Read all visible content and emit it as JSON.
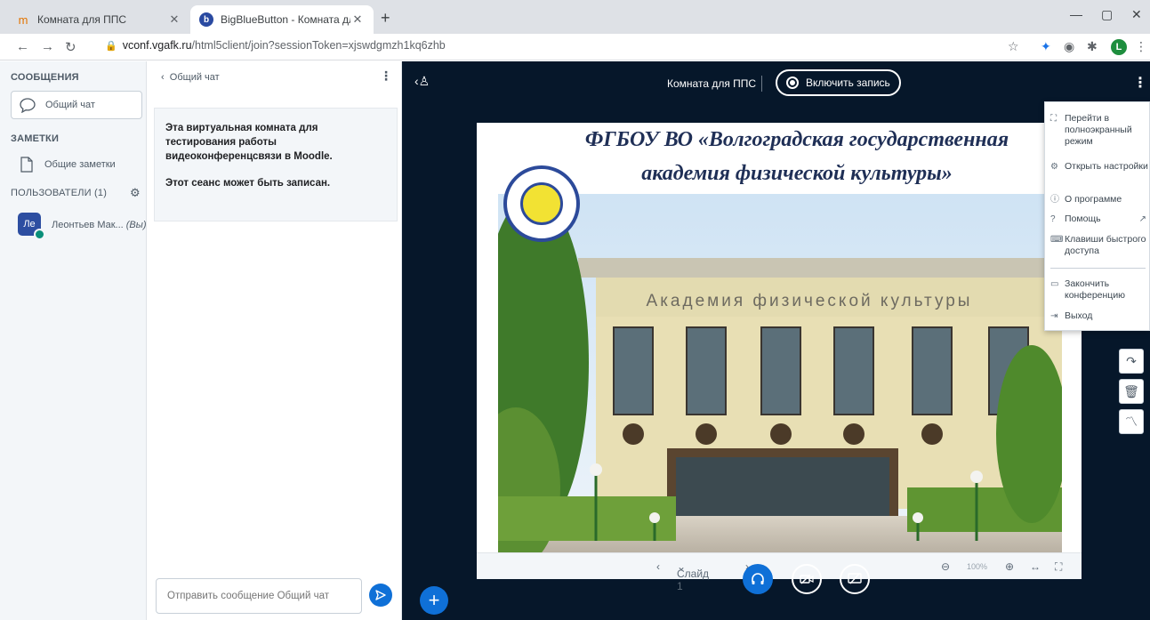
{
  "browser": {
    "tabs": [
      {
        "title": "Комната для ППС",
        "active": false
      },
      {
        "title": "BigBlueButton - Комната для ПП",
        "active": true
      }
    ],
    "url_host": "vconf.vgafk.ru",
    "url_path": "/html5client/join?sessionToken=xjswdgmzh1kq6zhb",
    "profile_initial": "L"
  },
  "sidebar": {
    "messages_header": "СООБЩЕНИЯ",
    "public_chat": "Общий чат",
    "notes_header": "ЗАМЕТКИ",
    "shared_notes": "Общие заметки",
    "users_header": "ПОЛЬЗОВАТЕЛИ (1)",
    "user": {
      "initials": "Ле",
      "name": "Леонтьев Мак...",
      "you": "(Вы)"
    }
  },
  "chat": {
    "header": "Общий чат",
    "welcome_line1": "Эта виртуальная комната для тестирования работы видеоконференцсвязи в Moodle.",
    "welcome_line2": "Этот сеанс может быть записан.",
    "input_placeholder": "Отправить сообщение Общий чат"
  },
  "main": {
    "room_title": "Комната для ППС",
    "record_label": "Включить запись"
  },
  "slide": {
    "title_line1": "ФГБОУ ВО «Волгоградская государственная",
    "title_line2": "академия физической культуры»",
    "building_sign": "Академия физической культуры",
    "slide_label": "Слайд 1",
    "zoom": "100%"
  },
  "menu": {
    "items": [
      {
        "icon": "fullscreen-icon",
        "label": "Перейти в полноэкранный режим"
      },
      {
        "icon": "settings-icon",
        "label": "Открыть настройки"
      },
      {
        "icon": "info-icon",
        "label": "О программе"
      },
      {
        "icon": "help-icon",
        "label": "Помощь"
      },
      {
        "icon": "keyboard-icon",
        "label": "Клавиши быстрого доступа"
      },
      {
        "icon": "end-meeting-icon",
        "label": "Закончить конференцию"
      },
      {
        "icon": "logout-icon",
        "label": "Выход"
      }
    ]
  }
}
